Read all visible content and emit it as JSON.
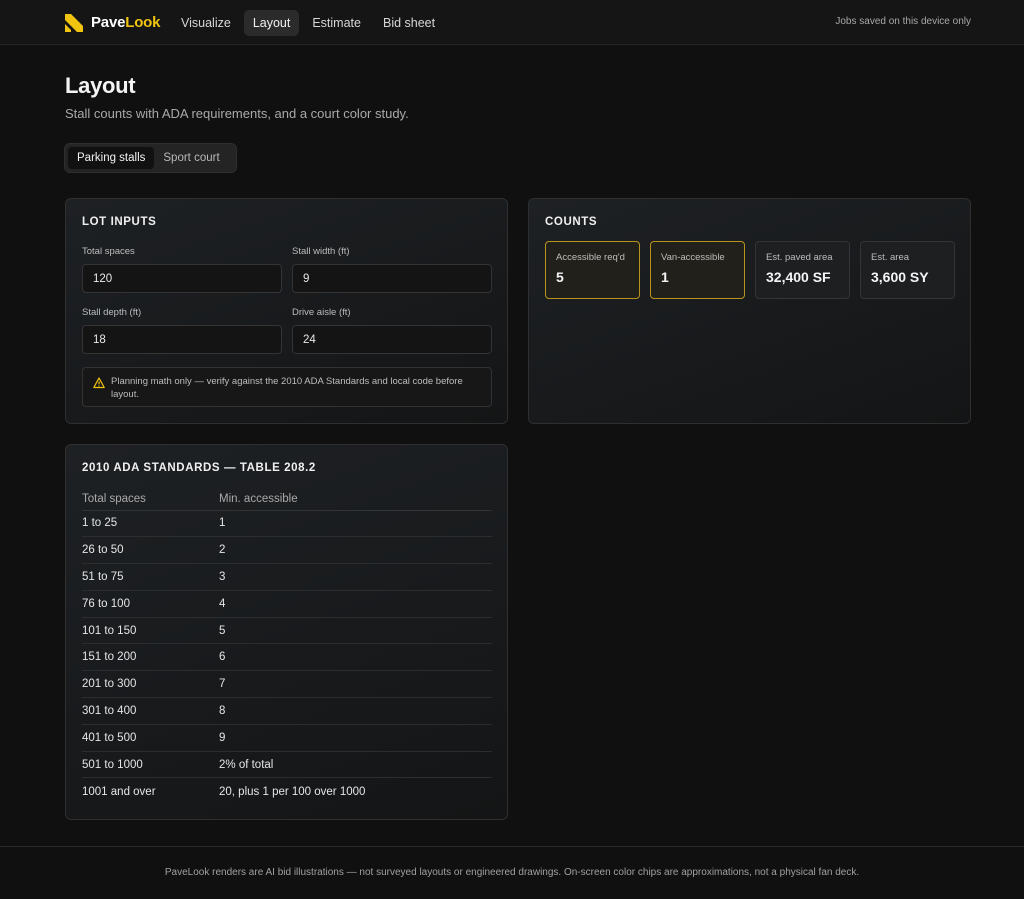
{
  "brand": {
    "name_part1": "Pave",
    "name_part2": "Look",
    "accent_color": "#f1c40f"
  },
  "nav": {
    "items": [
      {
        "label": "Visualize",
        "active": false
      },
      {
        "label": "Layout",
        "active": true
      },
      {
        "label": "Estimate",
        "active": false
      },
      {
        "label": "Bid sheet",
        "active": false
      }
    ],
    "status_text": "Jobs saved on this device only"
  },
  "page": {
    "title": "Layout",
    "subtitle": "Stall counts with ADA requirements, and a court color study."
  },
  "tabs": [
    {
      "label": "Parking stalls",
      "active": true
    },
    {
      "label": "Sport court",
      "active": false
    }
  ],
  "lot_inputs": {
    "title": "LOT INPUTS",
    "total_spaces": {
      "label": "Total spaces",
      "value": "120"
    },
    "stall_width": {
      "label": "Stall width (ft)",
      "value": "9"
    },
    "stall_depth": {
      "label": "Stall depth (ft)",
      "value": "18"
    },
    "drive_aisle": {
      "label": "Drive aisle (ft)",
      "value": "24"
    },
    "notice": "Planning math only — verify against the 2010 ADA Standards and local code before layout.",
    "notice_icon": "warning-icon"
  },
  "counts": {
    "title": "COUNTS",
    "stats": [
      {
        "label": "Accessible req'd",
        "value": "5",
        "highlight": true
      },
      {
        "label": "Van-accessible",
        "value": "1",
        "highlight": true
      },
      {
        "label": "Est. paved area",
        "value": "32,400 SF",
        "highlight": false
      },
      {
        "label": "Est. area",
        "value": "3,600 SY",
        "highlight": false
      }
    ],
    "highlight_color": "#b8951a"
  },
  "ada_table": {
    "title": "2010 ADA STANDARDS — TABLE 208.2",
    "headers": [
      "Total spaces",
      "Min. accessible"
    ],
    "rows": [
      [
        "1 to 25",
        "1"
      ],
      [
        "26 to 50",
        "2"
      ],
      [
        "51 to 75",
        "3"
      ],
      [
        "76 to 100",
        "4"
      ],
      [
        "101 to 150",
        "5"
      ],
      [
        "151 to 200",
        "6"
      ],
      [
        "201 to 300",
        "7"
      ],
      [
        "301 to 400",
        "8"
      ],
      [
        "401 to 500",
        "9"
      ],
      [
        "501 to 1000",
        "2% of total"
      ],
      [
        "1001 and over",
        "20, plus 1 per 100 over 1000"
      ]
    ]
  },
  "footer": {
    "text": "PaveLook renders are AI bid illustrations — not surveyed layouts or engineered drawings. On-screen color chips are approximations, not a physical fan deck."
  }
}
